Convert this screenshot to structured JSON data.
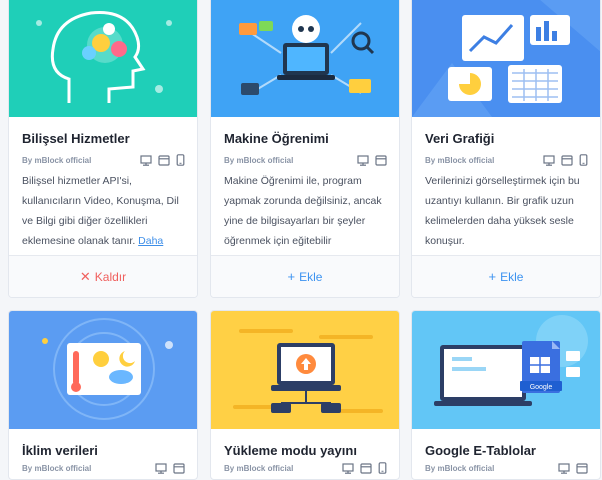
{
  "cards": [
    {
      "title": "Bilişsel Hizmetler",
      "author": "By mBlock official",
      "description": "Bilişsel hizmetler API'si, kullanıcıların Video, Konuşma, Dil ve Bilgi gibi diğer özellikleri eklemesine olanak tanır.",
      "more_link": "Daha",
      "action_symbol": "✕",
      "action_label": "Kaldır",
      "action": "remove",
      "thumbnail_color": "#1fcfb8",
      "devices": [
        "desktop-icon",
        "window-icon",
        "mobile-icon"
      ]
    },
    {
      "title": "Makine Öğrenimi",
      "author": "By mBlock official",
      "description": "Makine Öğrenimi ile, program yapmak zorunda değilsiniz, ancak yine de bilgisayarları bir şeyler öğrenmek için eğitebilir",
      "action_symbol": "+",
      "action_label": "Ekle",
      "action": "add",
      "thumbnail_color": "#3fa3f5",
      "devices": [
        "desktop-icon",
        "window-icon"
      ]
    },
    {
      "title": "Veri Grafiği",
      "author": "By mBlock official",
      "description": "Verilerinizi görselleştirmek için bu uzantıyı kullanın. Bir grafik uzun kelimelerden daha yüksek sesle konuşur.",
      "action_symbol": "+",
      "action_label": "Ekle",
      "action": "add",
      "thumbnail_color": "#4a8ff0",
      "devices": [
        "desktop-icon",
        "window-icon",
        "mobile-icon"
      ]
    },
    {
      "title": "İklim verileri",
      "author": "By mBlock official",
      "thumbnail_color": "#5b9cf2",
      "devices": [
        "desktop-icon",
        "window-icon"
      ]
    },
    {
      "title": "Yükleme modu yayını",
      "author": "By mBlock official",
      "thumbnail_color": "#ffd045",
      "devices": [
        "desktop-icon",
        "window-icon",
        "mobile-icon"
      ]
    },
    {
      "title": "Google E-Tablolar",
      "author": "By mBlock official",
      "thumbnail_color": "#62c6f6",
      "thumbnail_text": "Google",
      "devices": [
        "desktop-icon",
        "window-icon"
      ]
    }
  ]
}
